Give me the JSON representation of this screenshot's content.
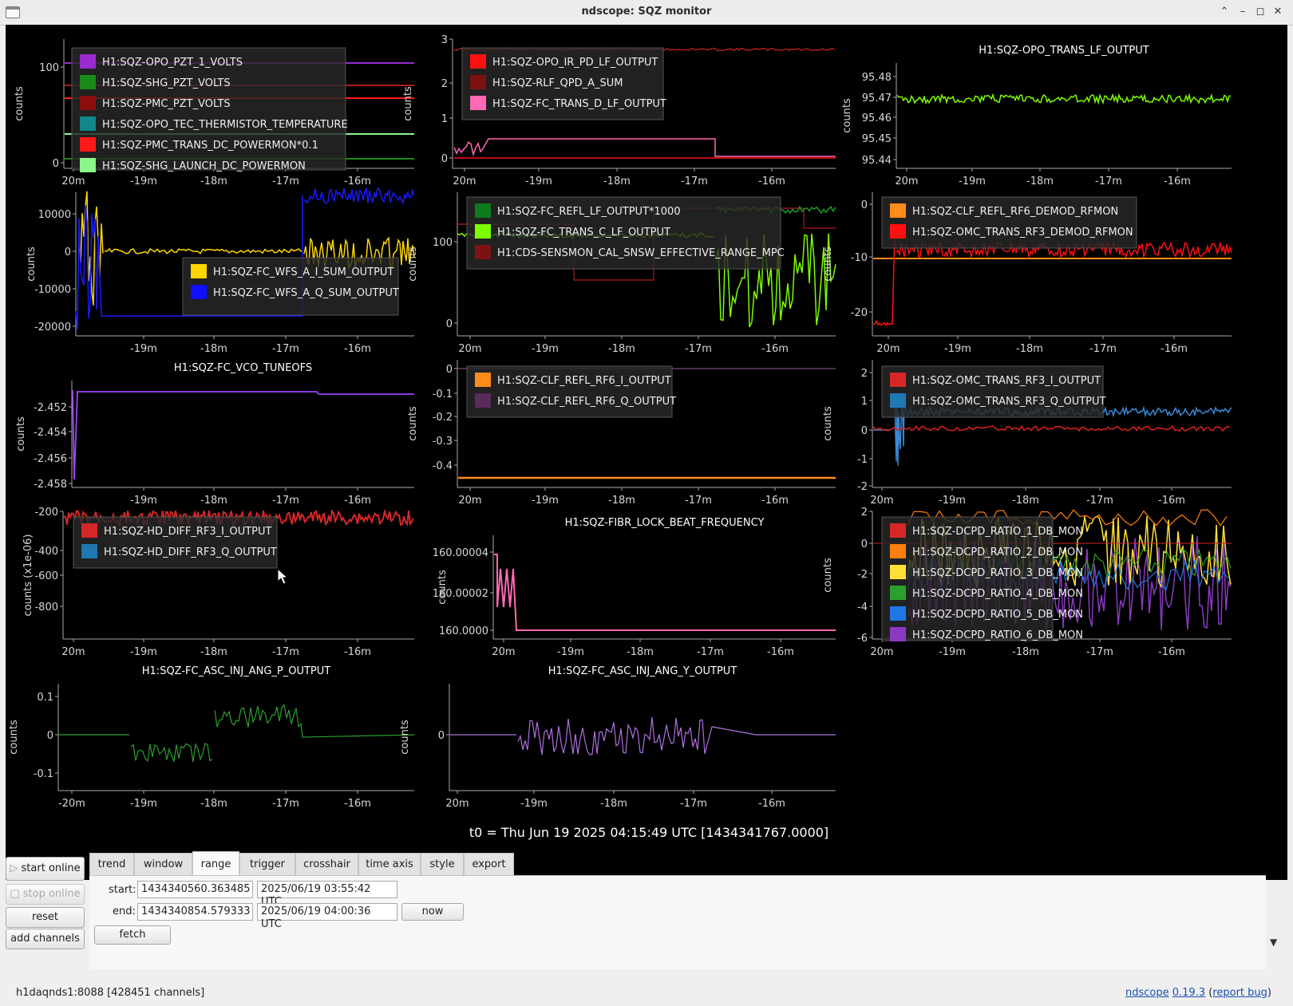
{
  "window": {
    "title": "ndscope: SQZ monitor"
  },
  "time_ticks": [
    "20m",
    "-19m",
    "-18m",
    "-17m",
    "-16m"
  ],
  "time_ticks_neg": [
    "-20m",
    "-19m",
    "-18m",
    "-17m",
    "-16m"
  ],
  "ylabel_counts": "counts",
  "ylabel_counts_e6": "counts (x1e-06)",
  "colors": {
    "bg": "#000000",
    "axis": "#bbbbbb"
  },
  "plots": {
    "p11": {
      "title": "",
      "yticks": [
        "100",
        "0"
      ],
      "legend": [
        {
          "name": "H1:SQZ-OPO_PZT_1_VOLTS",
          "color": "#9a2bd1"
        },
        {
          "name": "H1:SQZ-SHG_PZT_VOLTS",
          "color": "#1a8a1a"
        },
        {
          "name": "H1:SQZ-PMC_PZT_VOLTS",
          "color": "#8b0d0d"
        },
        {
          "name": "H1:SQZ-OPO_TEC_THERMISTOR_TEMPERATURE",
          "color": "#10878a"
        },
        {
          "name": "H1:SQZ-PMC_TRANS_DC_POWERMON*0.1",
          "color": "#ff1a1a"
        },
        {
          "name": "H1:SQZ-SHG_LAUNCH_DC_POWERMON",
          "color": "#8cf58c"
        }
      ]
    },
    "p12": {
      "title": "",
      "yticks": [
        "3",
        "2",
        "1",
        "0"
      ],
      "legend": [
        {
          "name": "H1:SQZ-OPO_IR_PD_LF_OUTPUT",
          "color": "#ff1010"
        },
        {
          "name": "H1:SQZ-RLF_QPD_A_SUM",
          "color": "#7d1212"
        },
        {
          "name": "H1:SQZ-FC_TRANS_D_LF_OUTPUT",
          "color": "#ff69b4"
        }
      ]
    },
    "p13": {
      "title": "H1:SQZ-OPO_TRANS_LF_OUTPUT",
      "yticks": [
        "95.48",
        "95.47",
        "95.46",
        "95.45",
        "95.44"
      ],
      "legend": []
    },
    "p21": {
      "title": "",
      "yticks": [
        "10000",
        "0",
        "-10000",
        "-20000"
      ],
      "legend": [
        {
          "name": "H1:SQZ-FC_WFS_A_I_SUM_OUTPUT",
          "color": "#ffd700"
        },
        {
          "name": "H1:SQZ-FC_WFS_A_Q_SUM_OUTPUT",
          "color": "#1010ff"
        }
      ]
    },
    "p22": {
      "title": "",
      "yticks": [
        "100",
        "0"
      ],
      "legend": [
        {
          "name": "H1:SQZ-FC_REFL_LF_OUTPUT*1000",
          "color": "#0e7a1e"
        },
        {
          "name": "H1:SQZ-FC_TRANS_C_LF_OUTPUT",
          "color": "#7cfc00"
        },
        {
          "name": "H1:CDS-SENSMON_CAL_SNSW_EFFECTIVE_RANGE_MPC",
          "color": "#7d1212"
        }
      ]
    },
    "p23": {
      "title": "",
      "yticks": [
        "0",
        "-10",
        "-20"
      ],
      "legend": [
        {
          "name": "H1:SQZ-CLF_REFL_RF6_DEMOD_RFMON",
          "color": "#ff8c1a"
        },
        {
          "name": "H1:SQZ-OMC_TRANS_RF3_DEMOD_RFMON",
          "color": "#ff1010"
        }
      ]
    },
    "p31": {
      "title": "H1:SQZ-FC_VCO_TUNEOFS",
      "yticks": [
        "-2.452",
        "-2.454",
        "-2.456",
        "-2.458"
      ],
      "legend": []
    },
    "p32": {
      "title": "",
      "yticks": [
        "0",
        "-0.1",
        "-0.2",
        "-0.3",
        "-0.4"
      ],
      "legend": [
        {
          "name": "H1:SQZ-CLF_REFL_RF6_I_OUTPUT",
          "color": "#ff8c1a"
        },
        {
          "name": "H1:SQZ-CLF_REFL_RF6_Q_OUTPUT",
          "color": "#5a2a5a"
        }
      ]
    },
    "p33": {
      "title": "",
      "yticks": [
        "2",
        "1",
        "0",
        "-1",
        "-2"
      ],
      "legend": [
        {
          "name": "H1:SQZ-OMC_TRANS_RF3_I_OUTPUT",
          "color": "#d62728"
        },
        {
          "name": "H1:SQZ-OMC_TRANS_RF3_Q_OUTPUT",
          "color": "#1f77b4"
        }
      ]
    },
    "p41": {
      "title": "",
      "yticks": [
        "-200",
        "-400",
        "-600",
        "-800"
      ],
      "legend": [
        {
          "name": "H1:SQZ-HD_DIFF_RF3_I_OUTPUT",
          "color": "#d62728"
        },
        {
          "name": "H1:SQZ-HD_DIFF_RF3_Q_OUTPUT",
          "color": "#1f77b4"
        }
      ]
    },
    "p42": {
      "title": "H1:SQZ-FIBR_LOCK_BEAT_FREQUENCY",
      "yticks": [
        "160.00004",
        "160.00002",
        "160.0000"
      ],
      "legend": []
    },
    "p43": {
      "title": "",
      "yticks": [
        "2",
        "0",
        "-2",
        "-4",
        "-6"
      ],
      "legend": [
        {
          "name": "H1:SQZ-DCPD_RATIO_1_DB_MON",
          "color": "#d62728"
        },
        {
          "name": "H1:SQZ-DCPD_RATIO_2_DB_MON",
          "color": "#ff7f0e"
        },
        {
          "name": "H1:SQZ-DCPD_RATIO_3_DB_MON",
          "color": "#ffe135"
        },
        {
          "name": "H1:SQZ-DCPD_RATIO_4_DB_MON",
          "color": "#2ca02c"
        },
        {
          "name": "H1:SQZ-DCPD_RATIO_5_DB_MON",
          "color": "#1f77e4"
        },
        {
          "name": "H1:SQZ-DCPD_RATIO_6_DB_MON",
          "color": "#8a3ac0"
        }
      ]
    },
    "p51": {
      "title": "H1:SQZ-FC_ASC_INJ_ANG_P_OUTPUT",
      "yticks": [
        "0.1",
        "0",
        "-0.1"
      ],
      "legend": []
    },
    "p52": {
      "title": "H1:SQZ-FC_ASC_INJ_ANG_Y_OUTPUT",
      "yticks": [
        "0"
      ],
      "legend": []
    }
  },
  "t0": "t0 = Thu Jun 19 2025 04:15:49 UTC [1434341767.0000]",
  "controls": {
    "start_online": "start online",
    "stop_online": "stop online",
    "reset": "reset",
    "add_channels": "add channels",
    "tabs": [
      "trend",
      "window",
      "range",
      "trigger",
      "crosshair",
      "time axis",
      "style",
      "export"
    ],
    "active_tab": "range",
    "start_label": "start:",
    "end_label": "end:",
    "start_gps": "1434340560.363485",
    "start_utc": "2025/06/19 03:55:42 UTC",
    "end_gps": "1434340854.579333",
    "end_utc": "2025/06/19 04:00:36 UTC",
    "now": "now",
    "fetch": "fetch"
  },
  "status": {
    "server": "h1daqnds1:8088  [428451 channels]",
    "app": "ndscope",
    "version": "0.19.3",
    "report": "report bug"
  }
}
